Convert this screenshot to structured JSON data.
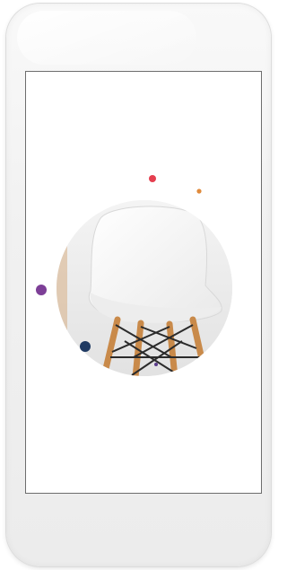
{
  "app": {
    "title": ""
  },
  "device": {
    "type": "smartphone mockup",
    "frame_color": "#f2f2f2",
    "screen_border_color": "#6d6d6d"
  },
  "screen": {
    "background": "#ffffff",
    "content": "chair-illustration",
    "colors": {
      "dot_red": "#e53f4f",
      "dot_orange": "#e08a3c",
      "dot_purple": "#7d3f97",
      "dot_navy": "#1f3a62",
      "dot_violet": "#5a3c8a",
      "chair_seat": "#f5f5f5",
      "chair_legs": "#c98a4a",
      "chair_wires": "#2b2b2b",
      "circle_bg": "#ececec"
    }
  }
}
